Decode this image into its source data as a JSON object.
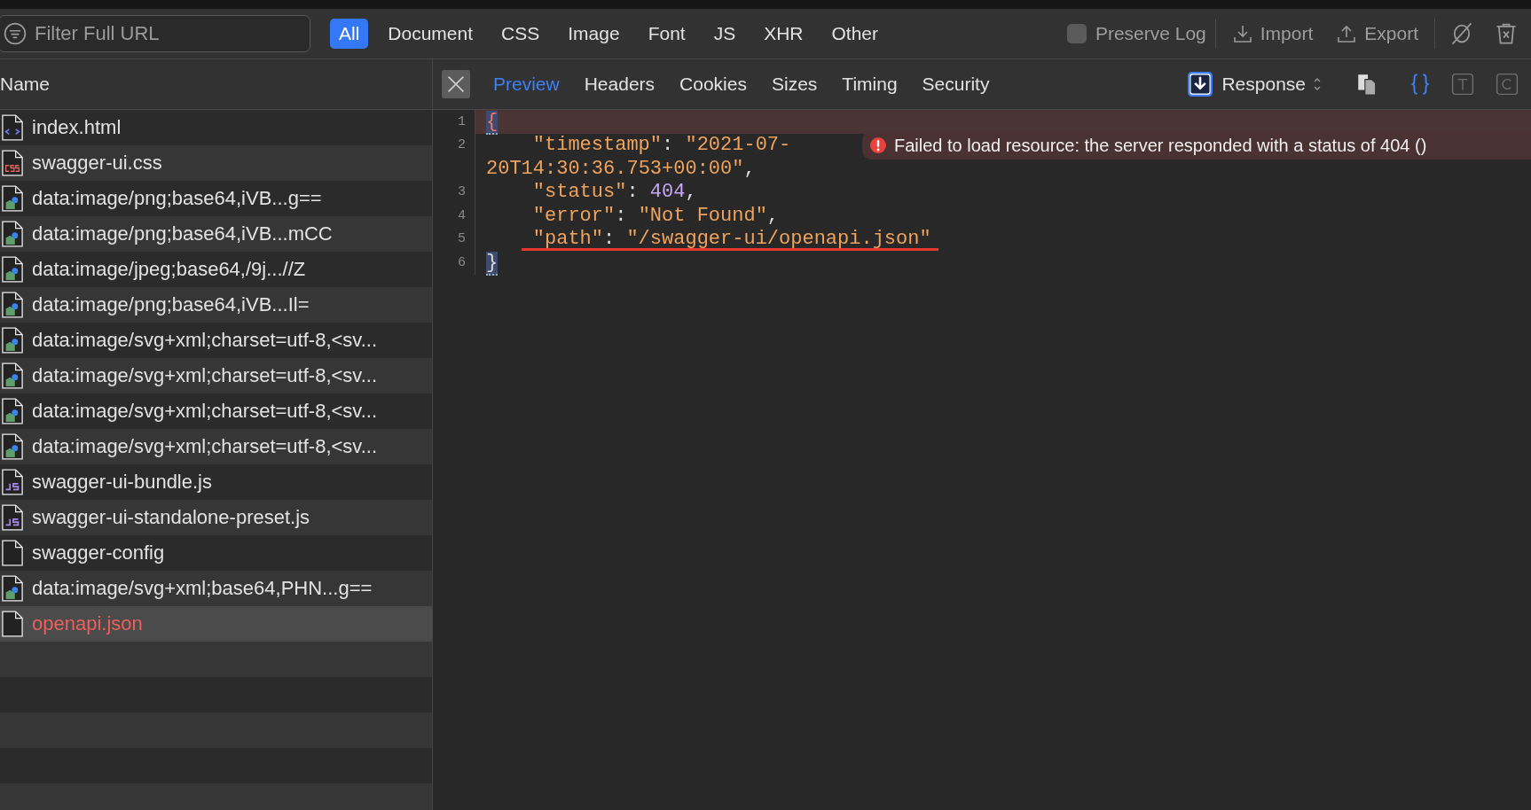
{
  "toolbar": {
    "filter": {
      "placeholder": "Filter Full URL"
    },
    "type_filters": [
      {
        "label": "All",
        "selected": true
      },
      {
        "label": "Document",
        "selected": false
      },
      {
        "label": "CSS",
        "selected": false
      },
      {
        "label": "Image",
        "selected": false
      },
      {
        "label": "Font",
        "selected": false
      },
      {
        "label": "JS",
        "selected": false
      },
      {
        "label": "XHR",
        "selected": false
      },
      {
        "label": "Other",
        "selected": false
      }
    ],
    "preserve_log": {
      "label": "Preserve Log",
      "checked": false
    },
    "import_label": "Import",
    "export_label": "Export"
  },
  "list": {
    "header": "Name",
    "items": [
      {
        "name": "index.html",
        "kind": "html",
        "selected": false,
        "failed": false
      },
      {
        "name": "swagger-ui.css",
        "kind": "css",
        "selected": false,
        "failed": false
      },
      {
        "name": "data:image/png;base64,iVB...g==",
        "kind": "image",
        "selected": false,
        "failed": false
      },
      {
        "name": "data:image/png;base64,iVB...mCC",
        "kind": "image",
        "selected": false,
        "failed": false
      },
      {
        "name": "data:image/jpeg;base64,/9j...//Z",
        "kind": "image",
        "selected": false,
        "failed": false
      },
      {
        "name": "data:image/png;base64,iVB...Il=",
        "kind": "image",
        "selected": false,
        "failed": false
      },
      {
        "name": "data:image/svg+xml;charset=utf-8,<sv...",
        "kind": "image",
        "selected": false,
        "failed": false
      },
      {
        "name": "data:image/svg+xml;charset=utf-8,<sv...",
        "kind": "image",
        "selected": false,
        "failed": false
      },
      {
        "name": "data:image/svg+xml;charset=utf-8,<sv...",
        "kind": "image",
        "selected": false,
        "failed": false
      },
      {
        "name": "data:image/svg+xml;charset=utf-8,<sv...",
        "kind": "image",
        "selected": false,
        "failed": false
      },
      {
        "name": "swagger-ui-bundle.js",
        "kind": "js",
        "selected": false,
        "failed": false
      },
      {
        "name": "swagger-ui-standalone-preset.js",
        "kind": "js",
        "selected": false,
        "failed": false
      },
      {
        "name": "swagger-config",
        "kind": "file",
        "selected": false,
        "failed": false
      },
      {
        "name": "data:image/svg+xml;base64,PHN...g==",
        "kind": "image",
        "selected": false,
        "failed": false
      },
      {
        "name": "openapi.json",
        "kind": "file",
        "selected": true,
        "failed": true
      }
    ]
  },
  "detail": {
    "tabs": [
      {
        "label": "Preview",
        "selected": true
      },
      {
        "label": "Headers",
        "selected": false
      },
      {
        "label": "Cookies",
        "selected": false
      },
      {
        "label": "Sizes",
        "selected": false
      },
      {
        "label": "Timing",
        "selected": false
      },
      {
        "label": "Security",
        "selected": false
      }
    ],
    "source": {
      "label": "Response"
    },
    "view_modes": [
      {
        "kind": "braces",
        "selected": true
      },
      {
        "kind": "text",
        "selected": false
      },
      {
        "kind": "cookie",
        "selected": false
      }
    ],
    "code_lines": [
      {
        "number": "1",
        "error": true,
        "tokens": [
          {
            "kind": "brace",
            "text": "{",
            "matched": true
          }
        ]
      },
      {
        "number": "2",
        "error": false,
        "indented": true,
        "tokens": [
          {
            "kind": "string",
            "text": "\"timestamp\""
          },
          {
            "kind": "punct",
            "text": ": "
          },
          {
            "kind": "string",
            "text": "\"2021-07-"
          }
        ]
      },
      {
        "error": false,
        "tokens": [
          {
            "kind": "string",
            "text": "20T14:30:36.753+00:00\""
          },
          {
            "kind": "punct",
            "text": ","
          }
        ]
      },
      {
        "number": "3",
        "error": false,
        "indented": true,
        "tokens": [
          {
            "kind": "string",
            "text": "\"status\""
          },
          {
            "kind": "punct",
            "text": ": "
          },
          {
            "kind": "number",
            "text": "404"
          },
          {
            "kind": "punct",
            "text": ","
          }
        ]
      },
      {
        "number": "4",
        "error": false,
        "indented": true,
        "tokens": [
          {
            "kind": "string",
            "text": "\"error\""
          },
          {
            "kind": "punct",
            "text": ": "
          },
          {
            "kind": "string",
            "text": "\"Not Found\""
          },
          {
            "kind": "punct",
            "text": ","
          }
        ]
      },
      {
        "number": "5",
        "error": false,
        "indented": true,
        "underlined": true,
        "tokens": [
          {
            "kind": "string",
            "text": "\"path\""
          },
          {
            "kind": "punct",
            "text": ": "
          },
          {
            "kind": "string",
            "text": "\"/swagger-ui/openapi.json\""
          }
        ]
      },
      {
        "number": "6",
        "error": false,
        "tokens": [
          {
            "kind": "brace",
            "text": "}",
            "matched": true
          }
        ]
      }
    ],
    "error_message": "Failed to load resource: the server responded with a status of 404 ()"
  }
}
